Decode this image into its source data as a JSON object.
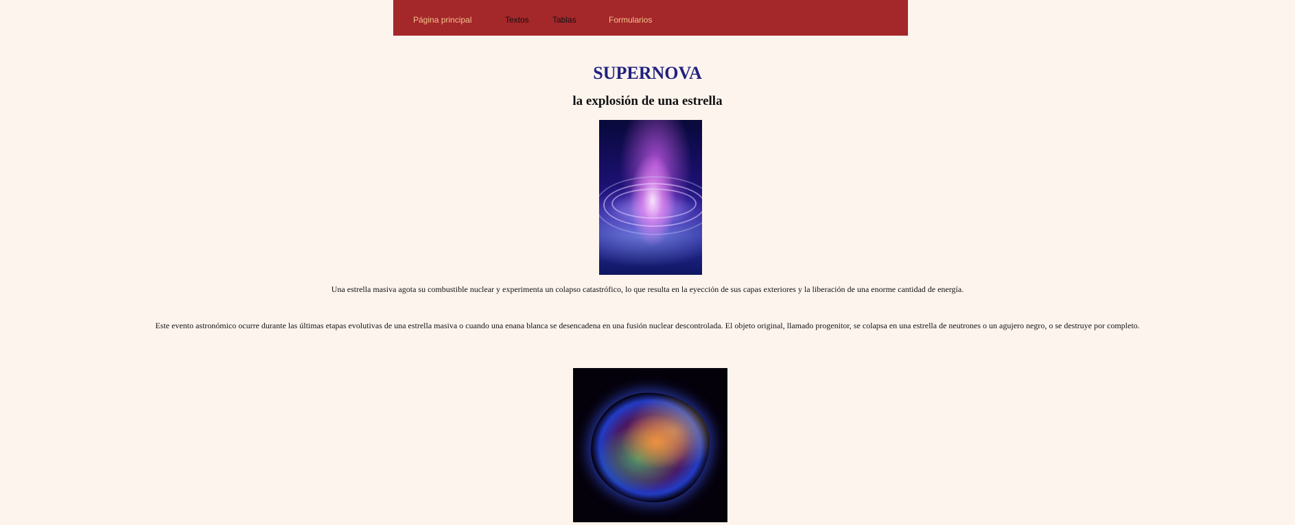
{
  "nav": {
    "home": "Página principal",
    "texts": "Textos",
    "tables": "Tablas",
    "forms": "Formularios"
  },
  "page": {
    "title": "SUPERNOVA",
    "subtitle": "la explosión de una estrella",
    "caption1": "Una estrella masiva agota su combustible nuclear y experimenta un colapso catastrófico, lo que resulta en la eyección de sus capas exteriores y la liberación de una enorme cantidad de energía.",
    "caption2": "Este evento astronómico ocurre durante las últimas etapas evolutivas de una estrella masiva o cuando una enana blanca se desencadena en una fusión nuclear descontrolada. El objeto original, llamado progenitor, se colapsa en una estrella de neutrones o un agujero negro, o se destruye por completo."
  },
  "colors": {
    "nav_bg": "#a4272a",
    "nav_link_active": "#f3c48a",
    "title": "#21217e",
    "page_bg": "#fdf4ee"
  }
}
